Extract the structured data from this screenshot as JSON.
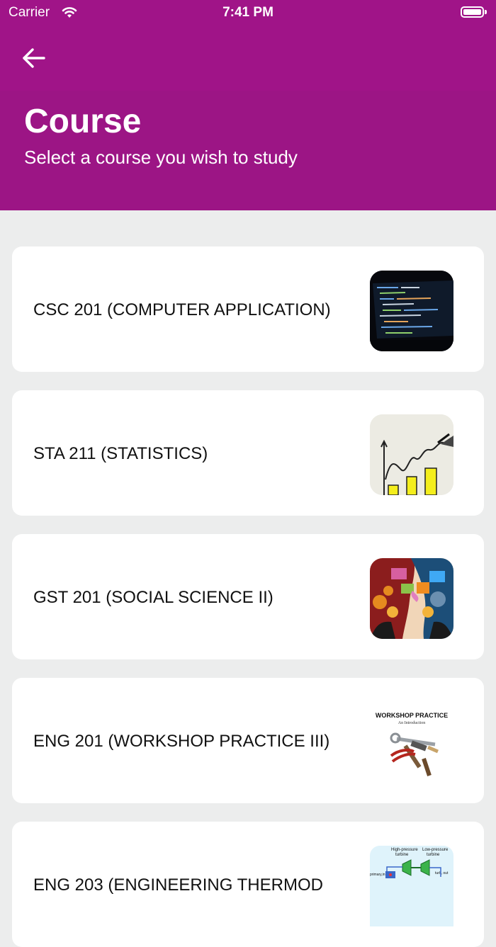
{
  "status_bar": {
    "carrier": "Carrier",
    "time": "7:41 PM"
  },
  "header": {
    "title": "Course",
    "subtitle": "Select a course you wish to study"
  },
  "courses": [
    {
      "label": "CSC 201 (COMPUTER APPLICATION)",
      "thumb": "code-screen-image"
    },
    {
      "label": "STA 211 (STATISTICS)",
      "thumb": "statistics-chart-image"
    },
    {
      "label": "GST 201 (SOCIAL SCIENCE II)",
      "thumb": "heads-gears-image"
    },
    {
      "label": "ENG 201 (WORKSHOP PRACTICE III)",
      "thumb": "workshop-tools-image",
      "thumb_title": "WORKSHOP PRACTICE",
      "thumb_subtitle": "An Introduction"
    },
    {
      "label": "ENG 203 (ENGINEERING THERMOD",
      "thumb": "turbine-diagram-image",
      "thumb_texts": [
        "High-pressure",
        "turbine",
        "Low-pressure",
        "turbine",
        "primary,in",
        "turb, out"
      ]
    }
  ],
  "colors": {
    "header": "#9c1585",
    "header_upper": "#a01488",
    "background": "#eceded",
    "card": "#ffffff"
  }
}
